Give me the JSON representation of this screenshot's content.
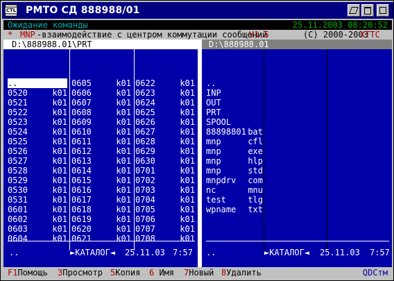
{
  "window": {
    "title": "РМТО СД 888988/01",
    "icon_label": "CTL"
  },
  "status": {
    "message": "Ожидание команды",
    "datetime": "25.11.2003 08:20:52"
  },
  "info": {
    "star": "*",
    "mnp": "MNP",
    "description": "-взаимодействие с центром коммутации сообщений",
    "version": "V1.5",
    "copyright": "(C) 2000-2003",
    "company": "ХТТС"
  },
  "left_panel": {
    "path": "D:\\888988.01\\PRT",
    "columns": [
      [
        {
          "name": "..",
          "ext": ""
        },
        {
          "name": "0520",
          "ext": "k01"
        },
        {
          "name": "0521",
          "ext": "k01"
        },
        {
          "name": "0522",
          "ext": "k01"
        },
        {
          "name": "0523",
          "ext": "k01"
        },
        {
          "name": "0524",
          "ext": "k01"
        },
        {
          "name": "0525",
          "ext": "k01"
        },
        {
          "name": "0526",
          "ext": "k01"
        },
        {
          "name": "0527",
          "ext": "k01"
        },
        {
          "name": "0528",
          "ext": "k01"
        },
        {
          "name": "0529",
          "ext": "k01"
        },
        {
          "name": "0530",
          "ext": "k01"
        },
        {
          "name": "0531",
          "ext": "k01"
        },
        {
          "name": "0601",
          "ext": "k01"
        },
        {
          "name": "0602",
          "ext": "k01"
        },
        {
          "name": "0603",
          "ext": "k01"
        },
        {
          "name": "0604",
          "ext": "k01"
        }
      ],
      [
        {
          "name": "0605",
          "ext": "k01"
        },
        {
          "name": "0606",
          "ext": "k01"
        },
        {
          "name": "0607",
          "ext": "k01"
        },
        {
          "name": "0608",
          "ext": "k01"
        },
        {
          "name": "0609",
          "ext": "k01"
        },
        {
          "name": "0610",
          "ext": "k01"
        },
        {
          "name": "0611",
          "ext": "k01"
        },
        {
          "name": "0612",
          "ext": "k01"
        },
        {
          "name": "0613",
          "ext": "k01"
        },
        {
          "name": "0614",
          "ext": "k01"
        },
        {
          "name": "0615",
          "ext": "k01"
        },
        {
          "name": "0616",
          "ext": "k01"
        },
        {
          "name": "0617",
          "ext": "k01"
        },
        {
          "name": "0618",
          "ext": "k01"
        },
        {
          "name": "0619",
          "ext": "k01"
        },
        {
          "name": "0620",
          "ext": "k01"
        },
        {
          "name": "0621",
          "ext": "k01"
        }
      ],
      [
        {
          "name": "0622",
          "ext": "k01"
        },
        {
          "name": "0623",
          "ext": "k01"
        },
        {
          "name": "0624",
          "ext": "k01"
        },
        {
          "name": "0625",
          "ext": "k01"
        },
        {
          "name": "0626",
          "ext": "k01"
        },
        {
          "name": "0627",
          "ext": "k01"
        },
        {
          "name": "0628",
          "ext": "k01"
        },
        {
          "name": "0629",
          "ext": "k01"
        },
        {
          "name": "0630",
          "ext": "k01"
        },
        {
          "name": "0701",
          "ext": "k01"
        },
        {
          "name": "0702",
          "ext": "k01"
        },
        {
          "name": "0703",
          "ext": "k01"
        },
        {
          "name": "0704",
          "ext": "k01"
        },
        {
          "name": "0705",
          "ext": "k01"
        },
        {
          "name": "0706",
          "ext": "k01"
        },
        {
          "name": "0707",
          "ext": "k01"
        },
        {
          "name": "0708",
          "ext": "k01"
        }
      ]
    ],
    "footer": {
      "name": "..",
      "type": "►КАТАЛОГ◄",
      "date": "25.11.03",
      "time": "7:57"
    }
  },
  "right_panel": {
    "path": "D:\\888988.01",
    "files": [
      {
        "name": "..",
        "ext": ""
      },
      {
        "name": "INP",
        "ext": ""
      },
      {
        "name": "OUT",
        "ext": ""
      },
      {
        "name": "PRT",
        "ext": ""
      },
      {
        "name": "SPOOL",
        "ext": ""
      },
      {
        "name": "88898801",
        "ext": "bat"
      },
      {
        "name": "mnp",
        "ext": "cfl"
      },
      {
        "name": "mnp",
        "ext": "exe"
      },
      {
        "name": "mnp",
        "ext": "hlp"
      },
      {
        "name": "mnp",
        "ext": "std"
      },
      {
        "name": "mnpdrv",
        "ext": "com"
      },
      {
        "name": "nc",
        "ext": "mnu"
      },
      {
        "name": "test",
        "ext": "tlg"
      },
      {
        "name": "wpname",
        "ext": "txt"
      }
    ],
    "footer": {
      "name": "..",
      "type": "►КАТАЛОГ◄",
      "date": "25.11.03",
      "time": "7:57"
    }
  },
  "keys": [
    {
      "num": "F1",
      "label": "Помощь"
    },
    {
      "num": "3",
      "label": "Просмотр"
    },
    {
      "num": "5",
      "label": "Копия"
    },
    {
      "num": "6",
      "label": " Имя"
    },
    {
      "num": "7",
      "label": "Новый"
    },
    {
      "num": "8",
      "label": "Удалить"
    }
  ],
  "brand": "QDCтм",
  "colors": {
    "panel": "#0000a8",
    "title": "#000080",
    "accent_red": "#a80000",
    "status_cyan": "#00a8a8",
    "status_green": "#00a800"
  }
}
